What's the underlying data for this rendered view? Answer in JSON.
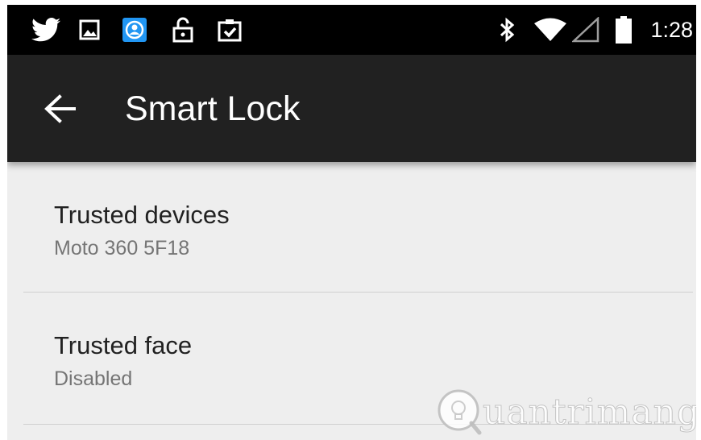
{
  "status_bar": {
    "time": "1:28",
    "icons": [
      "twitter-icon",
      "image-icon",
      "account-icon",
      "lock-open-icon",
      "clipboard-check-icon",
      "bluetooth-icon",
      "wifi-icon",
      "cellular-signal-icon",
      "battery-icon"
    ]
  },
  "app_bar": {
    "title": "Smart Lock",
    "back_icon": "arrow-back-icon"
  },
  "list": {
    "items": [
      {
        "title": "Trusted devices",
        "summary": "Moto 360 5F18"
      },
      {
        "title": "Trusted face",
        "summary": "Disabled"
      }
    ]
  },
  "watermark": {
    "text": "uantrimang"
  },
  "colors": {
    "status_bar_bg": "#000000",
    "app_bar_bg": "#212121",
    "background": "#eeeeee",
    "title_text": "#212121",
    "summary_text": "#757575",
    "account_icon_bg": "#2196f3"
  }
}
